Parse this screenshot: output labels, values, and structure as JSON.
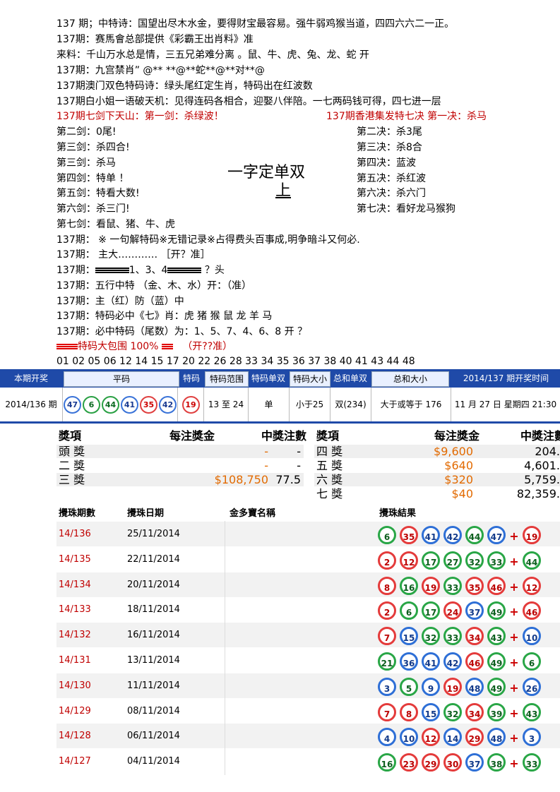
{
  "lines": {
    "l1": "137 期；中特诗：国望出尽木水金，要得财宝最容易。强牛弱鸡猴当道，四四六六二一正。",
    "l2": "137期：赛馬會总部提供《彩霸王出肖料》准",
    "l3": "来料：千山万水总是情，三五兄弟难分离 。鼠、牛、虎、兔、龙、蛇     开",
    "l4": "137期：九宫禁肖”  @** **@**蛇**@**对**@",
    "l5": "137期澳门双色特码诗：绿头尾红定生肖，特码出在红波数",
    "l6": "137期白小姐一语破天机：见得连码各相合，迎娶八伴陪。一七两码钱可得，四七进一层",
    "red_left": "137期七剑下天山：第一剑：杀绿波！",
    "red_right": "137期香港集发特七决 第一决：杀马"
  },
  "swords": [
    "第二剑：0尾!",
    "第三剑：杀四合!",
    "第三剑：杀马",
    "第四剑：特单 ！",
    "第五剑：特看大数!",
    "第六剑：杀三门!",
    "第七剑：看鼠、猪、牛、虎"
  ],
  "rules": [
    "第二决：杀3尾",
    "第三决：杀8合",
    "第四决：蓝波",
    "第五决：杀红波",
    "第六决：杀六门",
    "第七决：看好龙马猴狗"
  ],
  "center": {
    "line1": "一字定单双",
    "line2": "上"
  },
  "more": {
    "m1": "137期： ※ 一句解特码※无错记录※占得费头百事成,明争暗斗又何必.",
    "m2": "137期： 主大………… ［开？准］",
    "m3a": "137期：",
    "m3b": "1、3、4",
    "m3c": " ？头",
    "m4": "137期：五行中特   （金、木、水）开：（准）",
    "m5": "137期：主（红）防（蓝）中",
    "m6": "137期：特码必中《七》肖：虎 猪 猴 鼠 龙 羊 马",
    "m7": "137期：必中特码（尾数）为：1、5、7、4、6、8       开 ？",
    "m8a": "特码大包围 100%",
    "m8b": "（开??准）",
    "m9": "01 02 05 06 12 14 15 17 20 22 26 28 33 34 35 36 37 38 40 41 43 44 48"
  },
  "result_header": {
    "c1": "本期开奖",
    "c2": "平码",
    "c3": "特码",
    "c4": "特码范围",
    "c5": "特码单双",
    "c6": "特码大小",
    "c7": "总和单双",
    "c8": "总和大小",
    "c9": "2014/137 期开奖时间"
  },
  "result_row": {
    "period": "2014/136 期",
    "balls": [
      {
        "n": "47",
        "c": "blue"
      },
      {
        "n": "6",
        "c": "green"
      },
      {
        "n": "44",
        "c": "green"
      },
      {
        "n": "41",
        "c": "blue"
      },
      {
        "n": "35",
        "c": "red"
      },
      {
        "n": "42",
        "c": "blue"
      }
    ],
    "special": {
      "n": "19",
      "c": "red"
    },
    "range": "13 至 24",
    "odd_even": "单",
    "size": "小于25",
    "sum_oe": "双(234)",
    "sum_size": "大于或等于 176",
    "time": "11 月 27 日  星期四  21:30"
  },
  "prize": {
    "h_item": "獎項",
    "h_amount": "每注獎金",
    "h_count": "中獎注數",
    "left": [
      {
        "name": "頭 獎",
        "amount": "-",
        "count": "-"
      },
      {
        "name": "二 獎",
        "amount": "-",
        "count": "-"
      },
      {
        "name": "三 獎",
        "amount": "$108,750",
        "count": "77.5"
      }
    ],
    "right": [
      {
        "name": "四 獎",
        "amount": "$9,600",
        "count": "204."
      },
      {
        "name": "五 獎",
        "amount": "$640",
        "count": "4,601."
      },
      {
        "name": "六 獎",
        "amount": "$320",
        "count": "5,759."
      },
      {
        "name": "七 獎",
        "amount": "$40",
        "count": "82,359."
      }
    ]
  },
  "draws_header": {
    "period": "攪珠期數",
    "date": "攪珠日期",
    "name": "金多寶名稱",
    "result": "攪珠結果"
  },
  "draws": [
    {
      "no": "14/136",
      "date": "25/11/2014",
      "balls": [
        [
          "6",
          "green"
        ],
        [
          "35",
          "red"
        ],
        [
          "41",
          "blue"
        ],
        [
          "42",
          "blue"
        ],
        [
          "44",
          "green"
        ],
        [
          "47",
          "blue"
        ]
      ],
      "sp": [
        "19",
        "red"
      ]
    },
    {
      "no": "14/135",
      "date": "22/11/2014",
      "balls": [
        [
          "2",
          "red"
        ],
        [
          "12",
          "red"
        ],
        [
          "17",
          "green"
        ],
        [
          "27",
          "green"
        ],
        [
          "32",
          "green"
        ],
        [
          "33",
          "green"
        ]
      ],
      "sp": [
        "44",
        "green"
      ]
    },
    {
      "no": "14/134",
      "date": "20/11/2014",
      "balls": [
        [
          "8",
          "red"
        ],
        [
          "16",
          "green"
        ],
        [
          "19",
          "red"
        ],
        [
          "33",
          "green"
        ],
        [
          "35",
          "red"
        ],
        [
          "46",
          "red"
        ]
      ],
      "sp": [
        "12",
        "red"
      ]
    },
    {
      "no": "14/133",
      "date": "18/11/2014",
      "balls": [
        [
          "2",
          "red"
        ],
        [
          "6",
          "green"
        ],
        [
          "17",
          "green"
        ],
        [
          "24",
          "red"
        ],
        [
          "37",
          "blue"
        ],
        [
          "49",
          "green"
        ]
      ],
      "sp": [
        "46",
        "red"
      ]
    },
    {
      "no": "14/132",
      "date": "16/11/2014",
      "balls": [
        [
          "7",
          "red"
        ],
        [
          "15",
          "blue"
        ],
        [
          "32",
          "green"
        ],
        [
          "33",
          "green"
        ],
        [
          "34",
          "red"
        ],
        [
          "43",
          "green"
        ]
      ],
      "sp": [
        "10",
        "blue"
      ]
    },
    {
      "no": "14/131",
      "date": "13/11/2014",
      "balls": [
        [
          "21",
          "green"
        ],
        [
          "36",
          "blue"
        ],
        [
          "41",
          "blue"
        ],
        [
          "42",
          "blue"
        ],
        [
          "46",
          "red"
        ],
        [
          "49",
          "green"
        ]
      ],
      "sp": [
        "6",
        "green"
      ]
    },
    {
      "no": "14/130",
      "date": "11/11/2014",
      "balls": [
        [
          "3",
          "blue"
        ],
        [
          "5",
          "green"
        ],
        [
          "9",
          "blue"
        ],
        [
          "19",
          "red"
        ],
        [
          "48",
          "blue"
        ],
        [
          "49",
          "green"
        ]
      ],
      "sp": [
        "26",
        "blue"
      ]
    },
    {
      "no": "14/129",
      "date": "08/11/2014",
      "balls": [
        [
          "7",
          "red"
        ],
        [
          "8",
          "red"
        ],
        [
          "15",
          "blue"
        ],
        [
          "32",
          "green"
        ],
        [
          "34",
          "red"
        ],
        [
          "39",
          "green"
        ]
      ],
      "sp": [
        "43",
        "green"
      ]
    },
    {
      "no": "14/128",
      "date": "06/11/2014",
      "balls": [
        [
          "4",
          "blue"
        ],
        [
          "10",
          "blue"
        ],
        [
          "12",
          "red"
        ],
        [
          "14",
          "blue"
        ],
        [
          "29",
          "red"
        ],
        [
          "48",
          "blue"
        ]
      ],
      "sp": [
        "3",
        "blue"
      ]
    },
    {
      "no": "14/127",
      "date": "04/11/2014",
      "balls": [
        [
          "16",
          "green"
        ],
        [
          "23",
          "red"
        ],
        [
          "29",
          "red"
        ],
        [
          "30",
          "red"
        ],
        [
          "37",
          "blue"
        ],
        [
          "38",
          "green"
        ]
      ],
      "sp": [
        "33",
        "green"
      ]
    }
  ]
}
